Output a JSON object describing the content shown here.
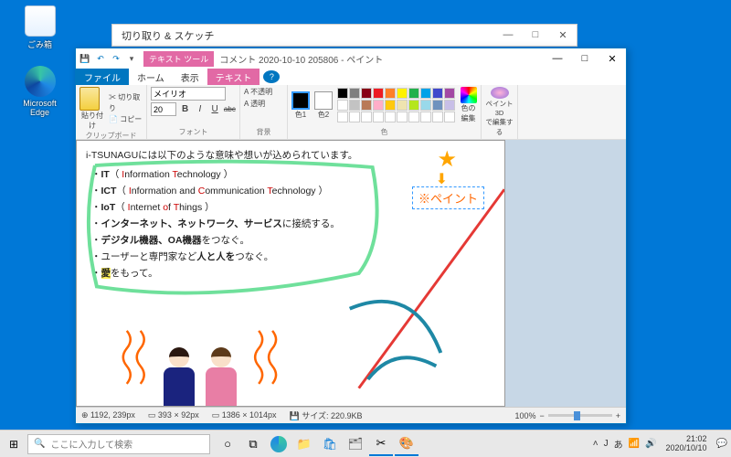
{
  "desktop": {
    "trash": "ごみ箱",
    "edge": "Microsoft Edge"
  },
  "snip": {
    "title": "切り取り & スケッチ",
    "min": "—",
    "max": "□",
    "close": "✕"
  },
  "paint": {
    "tool_tab": "テキスト ツール",
    "title": "コメント 2020-10-10 205806 - ペイント",
    "qat": {
      "save": "💾",
      "undo": "↶",
      "redo": "↷",
      "more": "▾"
    },
    "win": {
      "min": "—",
      "max": "□",
      "close": "✕"
    },
    "tabs": {
      "file": "ファイル",
      "home": "ホーム",
      "view": "表示",
      "text": "テキスト",
      "help": "?"
    },
    "ribbon": {
      "clipboard": {
        "paste": "貼り付け",
        "cut": "✂ 切り取り",
        "copy": "📄 コピー",
        "label": "クリップボード"
      },
      "font": {
        "name": "メイリオ",
        "size": "20",
        "b": "B",
        "i": "I",
        "u": "U",
        "s": "abc",
        "opaque": "A 不透明",
        "transparent": "A 透明",
        "label": "フォント"
      },
      "bg": {
        "label": "背景"
      },
      "colors": {
        "c1": "色1",
        "c2": "色2",
        "edit": "色の編集",
        "label": "色"
      },
      "p3d": {
        "line1": "ペイント 3D",
        "line2": "で編集する"
      }
    },
    "doc": {
      "intro": "i-TSUNAGUには以下のような意味や想いが込められています。",
      "items": [
        {
          "b": "IT",
          "paren_open": "（ ",
          "r1": "I",
          "t1": "nformation ",
          "r2": "T",
          "t2": "echnology ）"
        },
        {
          "b": "ICT",
          "paren_open": "（ ",
          "r1": "I",
          "t1": "nformation and ",
          "r2": "C",
          "t2": "ommunication ",
          "r3": "T",
          "t3": "echnology ）"
        },
        {
          "b": "IoT",
          "paren_open": "（ ",
          "r1": "I",
          "t1": "nternet ",
          "r2": "o",
          "t2": "f ",
          "r3": "T",
          "t3": "hings ）"
        },
        {
          "plain_pre": "",
          "b": "インターネット、ネットワーク、サービス",
          "plain_post": "に接続する。"
        },
        {
          "plain_pre": "",
          "b": "デジタル機器、OA機器",
          "plain_post": "をつなぐ。"
        },
        {
          "plain_pre": "ユーザーと専門家など",
          "b": "人と人を",
          "plain_post": "つなぐ。"
        },
        {
          "hl": "愛",
          "plain_post": "をもって。"
        }
      ],
      "annotation": "※ペイント",
      "star": "★",
      "arrow": "⬇"
    },
    "status": {
      "pos": "⊕ 1192, 239px",
      "sel": "▭ 393 × 92px",
      "canvas": "▭ 1386 × 1014px",
      "size": "💾 サイズ: 220.9KB",
      "zoom": "100%",
      "minus": "−",
      "plus": "+"
    }
  },
  "taskbar": {
    "search_placeholder": "ここに入力して検索",
    "search_icon": "🔍",
    "start": "⊞",
    "cortana": "○",
    "taskview": "⧉",
    "tray": {
      "up": "˄",
      "ime1": "J",
      "ime2": "あ",
      "net": "📶",
      "snd": "🔊",
      "act": "💬"
    },
    "time": "21:02",
    "date": "2020/10/10"
  },
  "palette": [
    "#000",
    "#7f7f7f",
    "#880015",
    "#ed1c24",
    "#ff7f27",
    "#fff200",
    "#22b14c",
    "#00a2e8",
    "#3f48cc",
    "#a349a4",
    "#fff",
    "#c3c3c3",
    "#b97a57",
    "#ffaec9",
    "#ffc90e",
    "#efe4b0",
    "#b5e61d",
    "#99d9ea",
    "#7092be",
    "#c8bfe7",
    "#fff",
    "#fff",
    "#fff",
    "#fff",
    "#fff",
    "#fff",
    "#fff",
    "#fff",
    "#fff",
    "#fff"
  ]
}
